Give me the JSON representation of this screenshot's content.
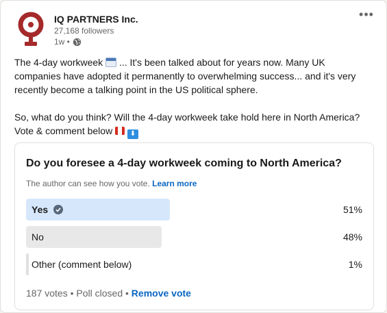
{
  "author": {
    "name": "IQ PARTNERS Inc.",
    "followers": "27,168 followers",
    "time": "1w •"
  },
  "post": {
    "line1": "The 4-day workweek",
    "line1_tail": " ... It's been talked about for years now. Many UK companies have adopted it permanently to overwhelming success... and it's very recently become a talking point in the US political sphere.",
    "line2": "So, what do you think? Will the 4-day workweek take hold here in North America? Vote & comment below"
  },
  "poll": {
    "question": "Do you foresee a 4-day workweek coming to North America?",
    "note": "The author can see how you vote.",
    "learn_more": "Learn more",
    "options": [
      {
        "label": "Yes",
        "percent": "51%",
        "share": 0.51,
        "selected": true
      },
      {
        "label": "No",
        "percent": "48%",
        "share": 0.48,
        "selected": false
      },
      {
        "label": "Other (comment below)",
        "percent": "1%",
        "share": 0.01,
        "selected": false
      }
    ],
    "votes": "187 votes",
    "status": "Poll closed",
    "remove_vote": "Remove vote"
  },
  "colors": {
    "brand": "#0a66c2",
    "logo_red": "#a52a2a",
    "selected_bar": "#d6e7fb",
    "bar": "#e8e8e8"
  }
}
